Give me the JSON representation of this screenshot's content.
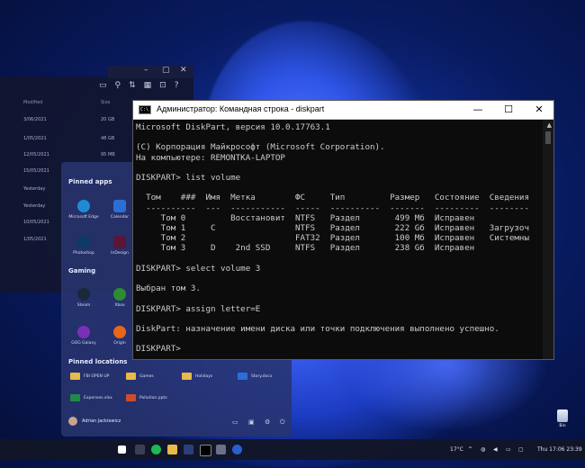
{
  "explorer": {
    "header_modified": "Modified",
    "header_size": "Size",
    "rows": [
      {
        "date": "3/06/2021",
        "size": "20 GB"
      },
      {
        "date": "1/05/2021",
        "size": "48 GB"
      },
      {
        "date": "12/05/2021",
        "size": "95 MB"
      },
      {
        "date": "15/05/2021",
        "size": ""
      },
      {
        "date": "Yesterday",
        "size": ""
      },
      {
        "date": "Yesterday",
        "size": ""
      },
      {
        "date": "10/05/2021",
        "size": ""
      },
      {
        "date": "1/05/2021",
        "size": ""
      }
    ]
  },
  "start_menu": {
    "pinned_apps_title": "Pinned apps",
    "pinned_apps": [
      {
        "label": "Microsoft Edge",
        "color": "#1f8ad6"
      },
      {
        "label": "Calendar",
        "color": "#2b6fd6"
      },
      {
        "label": "Photoshop",
        "color": "#0f3a66"
      },
      {
        "label": "InDesign",
        "color": "#5a1538"
      }
    ],
    "gaming_title": "Gaming",
    "gaming_apps": [
      {
        "label": "Steam",
        "color": "#1b2838"
      },
      {
        "label": "Xbox",
        "color": "#2e8b2e"
      },
      {
        "label": "GOG Galaxy",
        "color": "#7a2fb8"
      },
      {
        "label": "Origin",
        "color": "#e8651a"
      }
    ],
    "pinned_locations_title": "Pinned locations",
    "locations": [
      "FBI OPEN UP",
      "Games",
      "Holidays",
      "Story.docx",
      "Expenses.xlsx",
      "Pollution.pptx"
    ],
    "user_name": "Adrian Jackiewicz"
  },
  "cmd": {
    "title": "Администратор: Командная строка - diskpart",
    "icon_text": "C:\\",
    "minimize": "—",
    "maximize": "☐",
    "close": "✕",
    "lines": [
      "Microsoft DiskPart, версия 10.0.17763.1",
      "",
      "(C) Корпорация Майкрософт (Microsoft Corporation).",
      "На компьютере: REMONTKA-LAPTOP",
      "",
      "DISKPART> list volume",
      "",
      "  Том    ###  Имя  Метка        ФС     Тип         Размер   Состояние  Сведения",
      "  ----------  ---  -----------  -----  ----------  -------  ---------  --------",
      "     Том 0         Восстановит  NTFS   Раздел       499 Мб  Исправен",
      "     Том 1     C                NTFS   Раздел       222 Gб  Исправен   Загрузоч",
      "     Том 2                      FAT32  Раздел       100 Мб  Исправен   Системны",
      "     Том 3     D    2nd SSD     NTFS   Раздел       238 Gб  Исправен",
      "",
      "DISKPART> select volume 3",
      "",
      "Выбран том 3.",
      "",
      "DISKPART> assign letter=E",
      "",
      "DiskPart: назначение имени диска или точки подключения выполнено успешно.",
      "",
      "DISKPART> "
    ]
  },
  "desktop": {
    "recycle_label": "Bin"
  },
  "taskbar": {
    "weather": "17°C",
    "clock": "Thu 17:06 23:39"
  }
}
